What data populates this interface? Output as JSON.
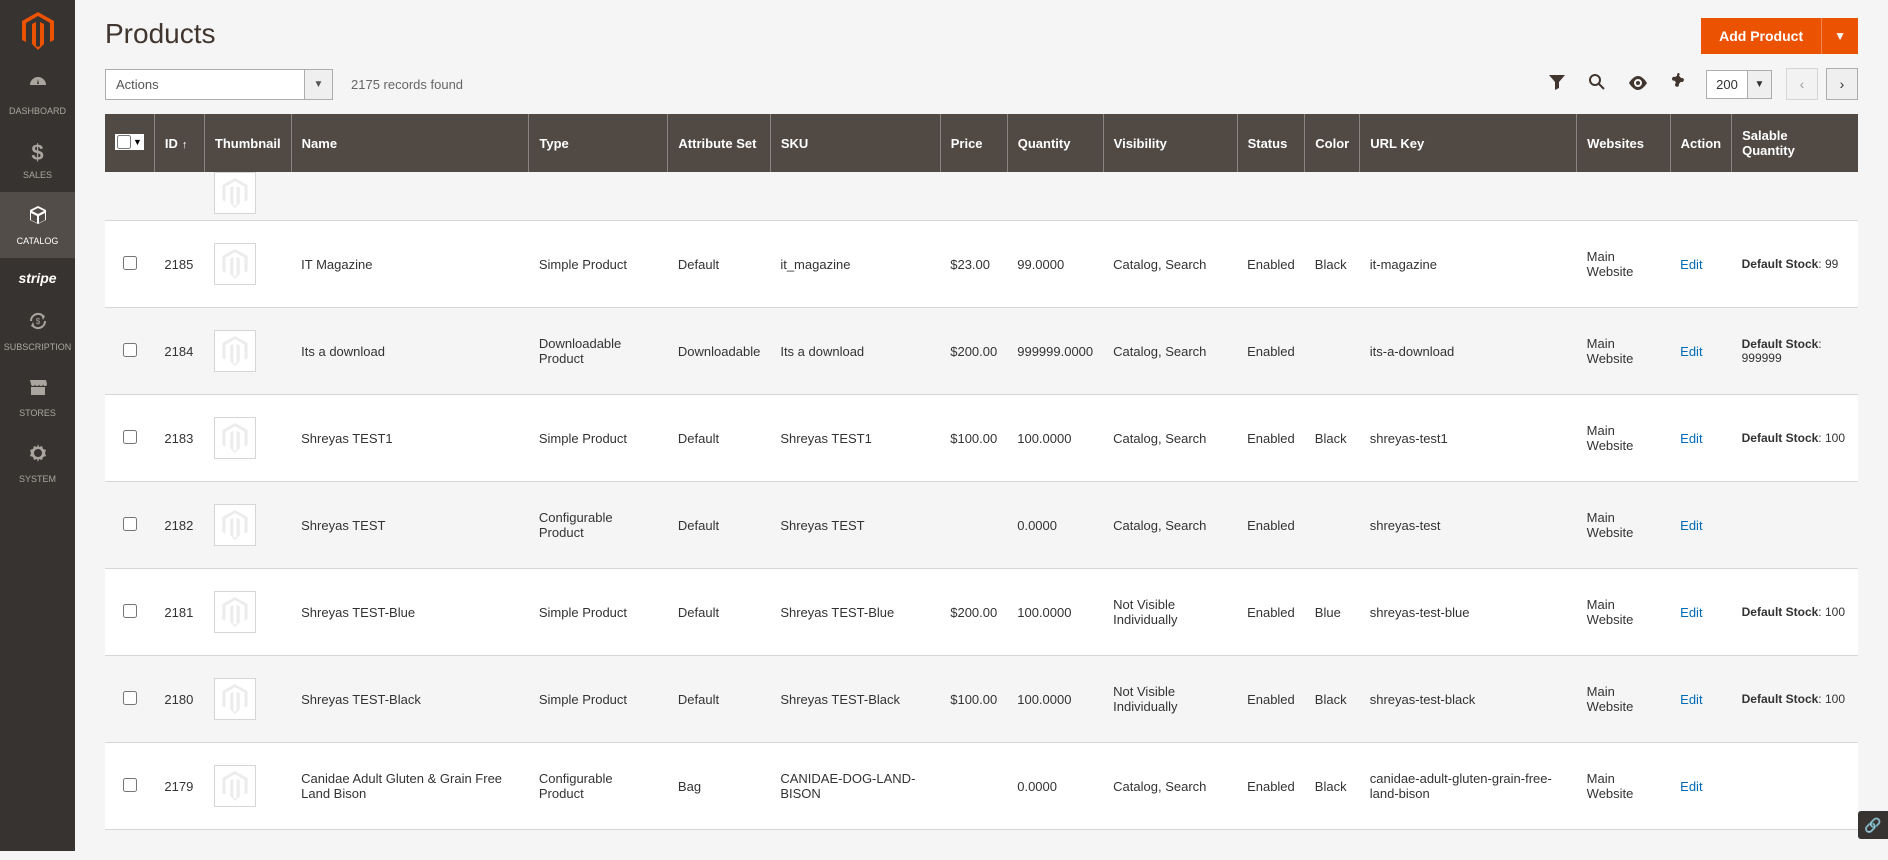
{
  "sidebar": {
    "items": [
      {
        "icon": "dashboard",
        "label": "DASHBOARD"
      },
      {
        "icon": "dollar",
        "label": "SALES"
      },
      {
        "icon": "cube",
        "label": "CATALOG"
      },
      {
        "icon": "stripe",
        "label": "stripe"
      },
      {
        "icon": "cycle",
        "label": "SUBSCRIPTION"
      },
      {
        "icon": "store",
        "label": "STORES"
      },
      {
        "icon": "gear",
        "label": "SYSTEM"
      }
    ]
  },
  "page": {
    "title": "Products"
  },
  "header": {
    "add_product": "Add Product"
  },
  "toolbar": {
    "actions_label": "Actions",
    "records_found": "2175 records found",
    "page_size": "200"
  },
  "columns": [
    "",
    "ID",
    "Thumbnail",
    "Name",
    "Type",
    "Attribute Set",
    "SKU",
    "Price",
    "Quantity",
    "Visibility",
    "Status",
    "Color",
    "URL Key",
    "Websites",
    "Action",
    "Salable Quantity"
  ],
  "rows": [
    {
      "partial": true,
      "id": "",
      "name": "",
      "type": "",
      "attrset": "",
      "sku": "",
      "price": "",
      "qty": "",
      "visibility": "",
      "status": "",
      "color": "",
      "url": "",
      "websites": "",
      "action": "",
      "salable_label": "",
      "salable_qty": ""
    },
    {
      "id": "2185",
      "name": "IT Magazine",
      "type": "Simple Product",
      "attrset": "Default",
      "sku": "it_magazine",
      "price": "$23.00",
      "qty": "99.0000",
      "visibility": "Catalog, Search",
      "status": "Enabled",
      "color": "Black",
      "url": "it-magazine",
      "websites": "Main Website",
      "action": "Edit",
      "salable_label": "Default Stock",
      "salable_qty": "99"
    },
    {
      "id": "2184",
      "name": "Its a download",
      "type": "Downloadable Product",
      "attrset": "Downloadable",
      "sku": "Its a download",
      "price": "$200.00",
      "qty": "999999.0000",
      "visibility": "Catalog, Search",
      "status": "Enabled",
      "color": "",
      "url": "its-a-download",
      "websites": "Main Website",
      "action": "Edit",
      "salable_label": "Default Stock",
      "salable_qty": "999999"
    },
    {
      "id": "2183",
      "name": "Shreyas TEST1",
      "type": "Simple Product",
      "attrset": "Default",
      "sku": "Shreyas TEST1",
      "price": "$100.00",
      "qty": "100.0000",
      "visibility": "Catalog, Search",
      "status": "Enabled",
      "color": "Black",
      "url": "shreyas-test1",
      "websites": "Main Website",
      "action": "Edit",
      "salable_label": "Default Stock",
      "salable_qty": "100"
    },
    {
      "id": "2182",
      "name": "Shreyas TEST",
      "type": "Configurable Product",
      "attrset": "Default",
      "sku": "Shreyas TEST",
      "price": "",
      "qty": "0.0000",
      "visibility": "Catalog, Search",
      "status": "Enabled",
      "color": "",
      "url": "shreyas-test",
      "websites": "Main Website",
      "action": "Edit",
      "salable_label": "",
      "salable_qty": ""
    },
    {
      "id": "2181",
      "name": "Shreyas TEST-Blue",
      "type": "Simple Product",
      "attrset": "Default",
      "sku": "Shreyas TEST-Blue",
      "price": "$200.00",
      "qty": "100.0000",
      "visibility": "Not Visible Individually",
      "status": "Enabled",
      "color": "Blue",
      "url": "shreyas-test-blue",
      "websites": "Main Website",
      "action": "Edit",
      "salable_label": "Default Stock",
      "salable_qty": "100"
    },
    {
      "id": "2180",
      "name": "Shreyas TEST-Black",
      "type": "Simple Product",
      "attrset": "Default",
      "sku": "Shreyas TEST-Black",
      "price": "$100.00",
      "qty": "100.0000",
      "visibility": "Not Visible Individually",
      "status": "Enabled",
      "color": "Black",
      "url": "shreyas-test-black",
      "websites": "Main Website",
      "action": "Edit",
      "salable_label": "Default Stock",
      "salable_qty": "100"
    },
    {
      "id": "2179",
      "name": "Canidae Adult Gluten & Grain Free Land Bison",
      "type": "Configurable Product",
      "attrset": "Bag",
      "sku": "CANIDAE-DOG-LAND-BISON",
      "price": "",
      "qty": "0.0000",
      "visibility": "Catalog, Search",
      "status": "Enabled",
      "color": "Black",
      "url": "canidae-adult-gluten-grain-free-land-bison",
      "websites": "Main Website",
      "action": "Edit",
      "salable_label": "",
      "salable_qty": ""
    }
  ]
}
